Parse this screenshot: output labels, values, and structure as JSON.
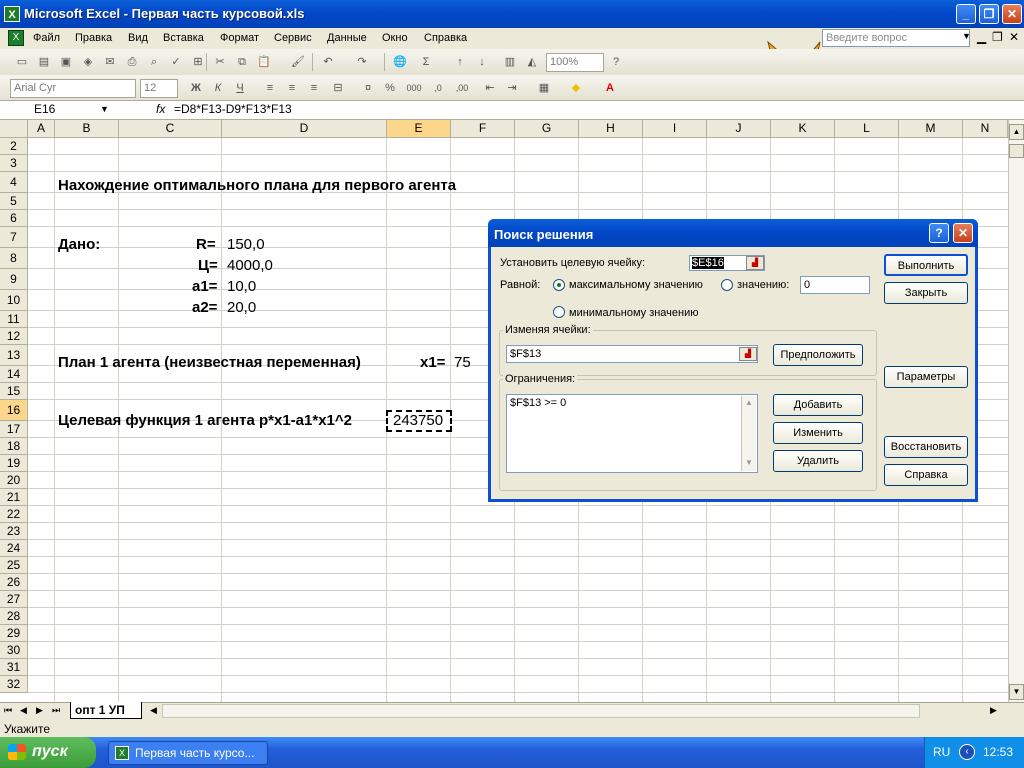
{
  "app": {
    "title": "Microsoft Excel - Первая часть курсовой.xls",
    "menu": [
      "Файл",
      "Правка",
      "Вид",
      "Вставка",
      "Формат",
      "Сервис",
      "Данные",
      "Окно",
      "Справка"
    ],
    "ask_placeholder": "Введите вопрос",
    "zoom": "100%",
    "font_name": "Arial Cyr",
    "font_size": "12",
    "name_box": "E16",
    "fx_label": "fx",
    "formula": "=D8*F13-D9*F13*F13"
  },
  "grid": {
    "columns": [
      "A",
      "B",
      "C",
      "D",
      "E",
      "F",
      "G",
      "H",
      "I",
      "J",
      "K",
      "L",
      "M",
      "N"
    ],
    "rows": [
      "2",
      "3",
      "4",
      "5",
      "6",
      "7",
      "8",
      "9",
      "10",
      "11",
      "12",
      "13",
      "14",
      "15",
      "16",
      "17",
      "18",
      "19",
      "20",
      "21",
      "22",
      "23",
      "24",
      "25",
      "26",
      "27",
      "28",
      "29",
      "30",
      "31",
      "32"
    ],
    "cells": {
      "B4": "Нахождение оптимального плана для первого агента",
      "B7": "Дано:",
      "C7": "R=",
      "D7": "150,0",
      "C8": "Ц=",
      "D8": "4000,0",
      "C9": "а1=",
      "D9": "10,0",
      "C10": "а2=",
      "D10": "20,0",
      "B13": "План 1 агента (неизвестная переменная)",
      "E13": "x1=",
      "F13": "75",
      "B16": "Целевая функция 1 агента p*x1-a1*x1^2",
      "E16": "243750"
    }
  },
  "sheet_tab": "опт 1 УП",
  "status": "Укажите",
  "taskbar": {
    "start": "пуск",
    "task": "Первая часть курсо...",
    "lang": "RU",
    "clock": "12:53"
  },
  "solver": {
    "title": "Поиск решения",
    "target_label": "Установить целевую ячейку:",
    "target_value": "$E$16",
    "equal_label": "Равной:",
    "opt_max": "максимальному значению",
    "opt_value": "значению:",
    "value_field": "0",
    "opt_min": "минимальному значению",
    "changing_label": "Изменяя ячейки:",
    "changing_value": "$F$13",
    "constraints_label": "Ограничения:",
    "constraints": [
      "$F$13 >= 0"
    ],
    "buttons": {
      "execute": "Выполнить",
      "close": "Закрыть",
      "guess": "Предположить",
      "params": "Параметры",
      "add": "Добавить",
      "change": "Изменить",
      "delete": "Удалить",
      "restore": "Восстановить",
      "help": "Справка"
    }
  }
}
